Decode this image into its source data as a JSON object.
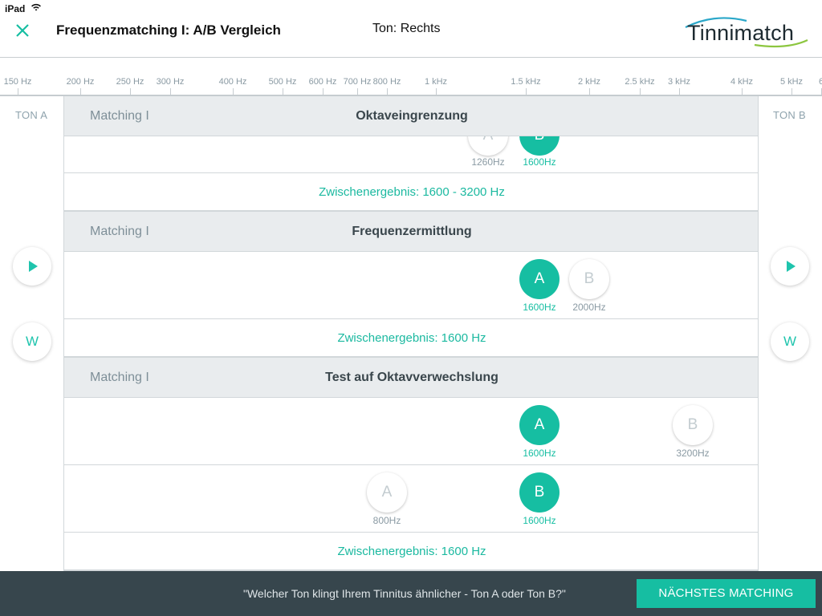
{
  "status": {
    "device": "iPad"
  },
  "header": {
    "title": "Frequenzmatching I: A/B Vergleich",
    "tone": "Ton: Rechts",
    "logo": "Tinnimatch"
  },
  "ruler": {
    "ticks": [
      "150 Hz",
      "200 Hz",
      "250 Hz",
      "300 Hz",
      "400 Hz",
      "500 Hz",
      "600 Hz",
      "700 Hz",
      "800 Hz",
      "1 kHz",
      "1.5 kHz",
      "2 kHz",
      "2.5 kHz",
      "3 kHz",
      "4 kHz",
      "5 kHz",
      "6"
    ]
  },
  "side": {
    "left_label": "TON A",
    "right_label": "TON B",
    "w_label": "W"
  },
  "sections": [
    {
      "step": "Matching I",
      "title": "Oktaveingrenzung",
      "rows": [
        {
          "tones": [
            {
              "letter": "A",
              "freq": "1260Hz",
              "selected": false
            },
            {
              "letter": "B",
              "freq": "1600Hz",
              "selected": true
            }
          ]
        }
      ],
      "result": "Zwischenergebnis: 1600 - 3200 Hz"
    },
    {
      "step": "Matching I",
      "title": "Frequenzermittlung",
      "rows": [
        {
          "tones": [
            {
              "letter": "A",
              "freq": "1600Hz",
              "selected": true
            },
            {
              "letter": "B",
              "freq": "2000Hz",
              "selected": false
            }
          ]
        }
      ],
      "result": "Zwischenergebnis: 1600 Hz"
    },
    {
      "step": "Matching I",
      "title": "Test auf Oktavverwechslung",
      "rows": [
        {
          "tones": [
            {
              "letter": "A",
              "freq": "1600Hz",
              "selected": true
            },
            {
              "letter": "B",
              "freq": "3200Hz",
              "selected": false
            }
          ]
        },
        {
          "tones": [
            {
              "letter": "A",
              "freq": "800Hz",
              "selected": false
            },
            {
              "letter": "B",
              "freq": "1600Hz",
              "selected": true
            }
          ]
        }
      ],
      "result": "Zwischenergebnis: 1600 Hz"
    }
  ],
  "bottom": {
    "question": "\"Welcher Ton klingt Ihrem Tinnitus ähnlicher - Ton A oder Ton B?\"",
    "next_button": "NÄCHSTES MATCHING"
  },
  "colors": {
    "accent": "#16bea2",
    "bottom_bar": "#37464d",
    "section_header": "#e9ecee"
  }
}
